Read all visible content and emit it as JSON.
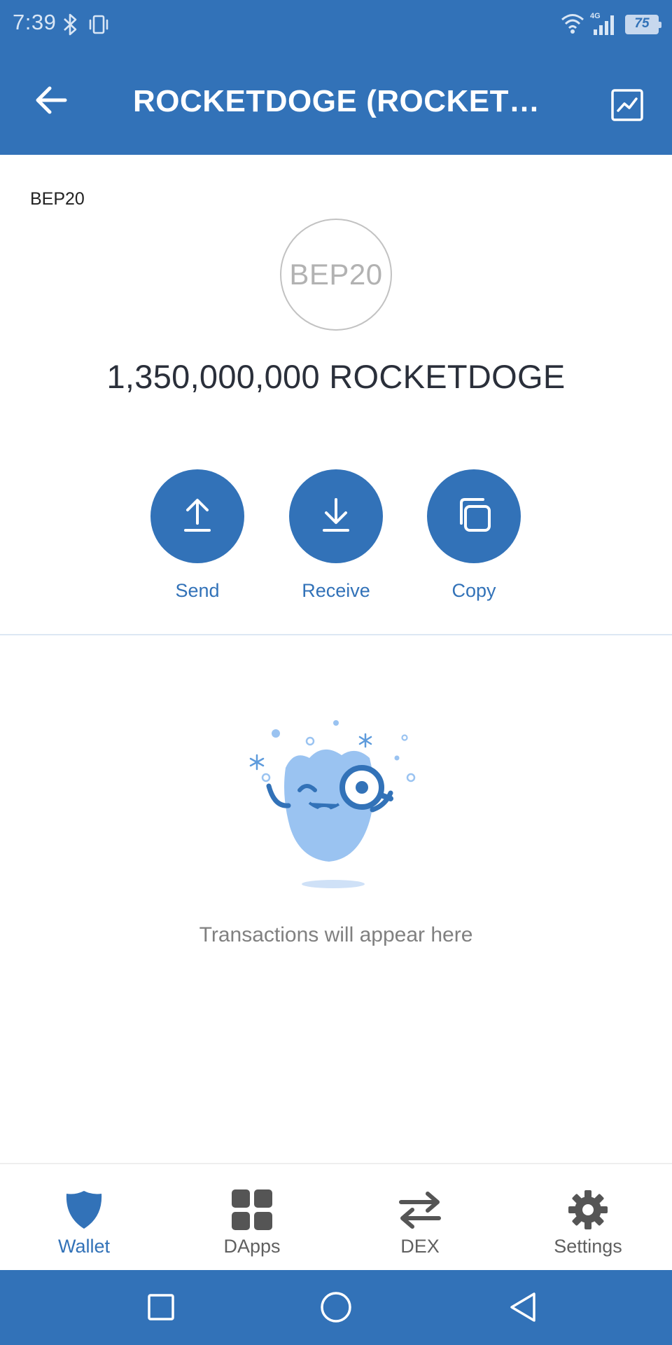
{
  "status_bar": {
    "time": "7:39",
    "network_label": "4G",
    "battery_level": "75",
    "icons": [
      "bluetooth-icon",
      "vibrate-icon",
      "wifi-icon",
      "signal-icon",
      "battery-icon"
    ]
  },
  "app_bar": {
    "title": "ROCKETDOGE (ROCKETDOGE)",
    "back_icon": "arrow-left-icon",
    "chart_icon": "chart-line-icon",
    "background_color": "#3272b8"
  },
  "token": {
    "network": "BEP20",
    "logo_text": "BEP20",
    "balance": "1,350,000,000 ROCKETDOGE"
  },
  "actions": [
    {
      "id": "send",
      "label": "Send",
      "icon": "upload-arrow-icon"
    },
    {
      "id": "receive",
      "label": "Receive",
      "icon": "download-arrow-icon"
    },
    {
      "id": "copy",
      "label": "Copy",
      "icon": "copy-icon"
    }
  ],
  "empty_state": {
    "message": "Transactions will appear here",
    "illustration": "winking-mascot-with-magnifier"
  },
  "bottom_nav": {
    "active": "wallet",
    "items": [
      {
        "id": "wallet",
        "label": "Wallet",
        "icon": "shield-icon"
      },
      {
        "id": "dapps",
        "label": "DApps",
        "icon": "grid-icon"
      },
      {
        "id": "dex",
        "label": "DEX",
        "icon": "swap-arrows-icon"
      },
      {
        "id": "settings",
        "label": "Settings",
        "icon": "gear-icon"
      }
    ]
  },
  "system_nav": {
    "buttons": [
      "recents-square-icon",
      "home-circle-icon",
      "back-triangle-icon"
    ]
  },
  "colors": {
    "primary": "#3272b8",
    "illustration_light": "#9ac3f1",
    "text_muted": "#808080"
  }
}
